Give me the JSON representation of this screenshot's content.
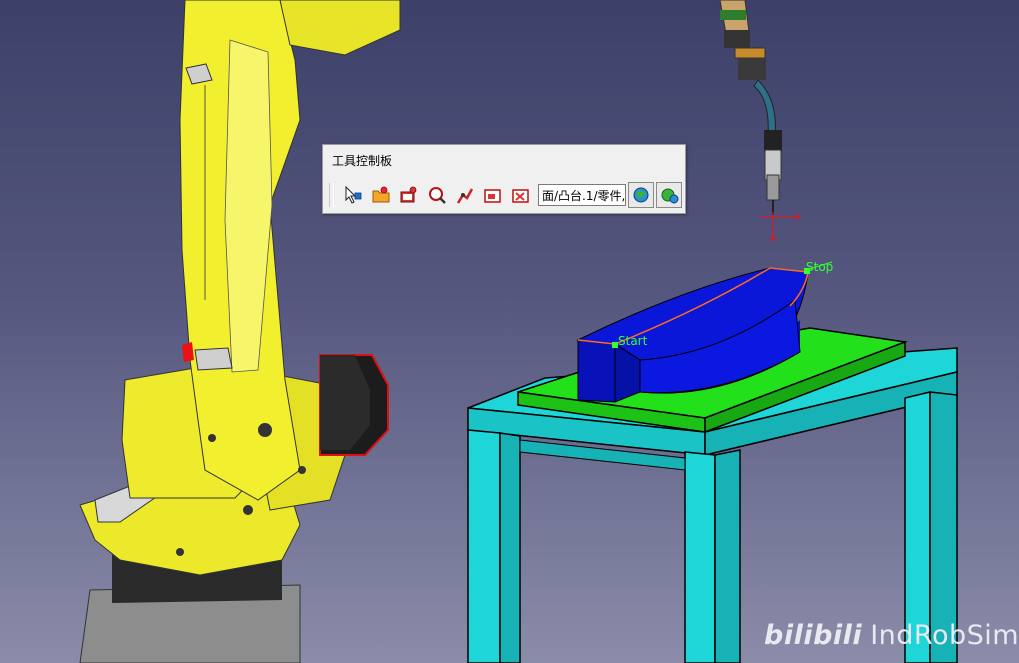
{
  "palette": {
    "title": "工具控制板",
    "field_value": "面/凸台.1/零件,"
  },
  "toolbar_icons": [
    "select-arrow-icon",
    "open-folder-icon",
    "camera-target-icon",
    "magnify-target-icon",
    "robot-arm-icon",
    "frame-target-icon",
    "frame-remove-icon",
    "globe-settings-icon",
    "globe-icon"
  ],
  "scene": {
    "start_label": "Start",
    "stop_label": "Stop"
  },
  "watermark": {
    "logo_text": "bilibili",
    "channel_name": "IndRobSim"
  },
  "colors": {
    "background_top": "#3d4068",
    "robot_yellow": "#f2ef2e",
    "table_cyan": "#1ed6d8",
    "plate_green": "#22e01a",
    "part_blue": "#0a16d8",
    "path_orange": "#ff6a1a"
  }
}
